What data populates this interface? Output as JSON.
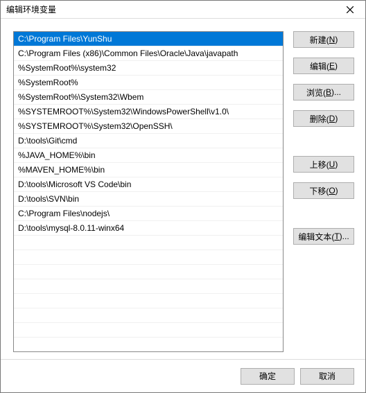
{
  "window": {
    "title": "编辑环境变量"
  },
  "path_entries": [
    "C:\\Program Files\\YunShu",
    "C:\\Program Files (x86)\\Common Files\\Oracle\\Java\\javapath",
    "%SystemRoot%\\system32",
    "%SystemRoot%",
    "%SystemRoot%\\System32\\Wbem",
    "%SYSTEMROOT%\\System32\\WindowsPowerShell\\v1.0\\",
    "%SYSTEMROOT%\\System32\\OpenSSH\\",
    "D:\\tools\\Git\\cmd",
    "%JAVA_HOME%\\bin",
    "%MAVEN_HOME%\\bin",
    "D:\\tools\\Microsoft VS Code\\bin",
    "D:\\tools\\SVN\\bin",
    "C:\\Program Files\\nodejs\\",
    "D:\\tools\\mysql-8.0.11-winx64"
  ],
  "selected_index": 0,
  "buttons": {
    "new": {
      "label": "新建",
      "hotkey": "N"
    },
    "edit": {
      "label": "编辑",
      "hotkey": "E"
    },
    "browse": {
      "label": "浏览",
      "hotkey": "B",
      "suffix": "..."
    },
    "delete": {
      "label": "删除",
      "hotkey": "D"
    },
    "move_up": {
      "label": "上移",
      "hotkey": "U"
    },
    "move_down": {
      "label": "下移",
      "hotkey": "O"
    },
    "edit_text": {
      "label": "编辑文本",
      "hotkey": "T",
      "suffix": "..."
    },
    "ok": {
      "label": "确定"
    },
    "cancel": {
      "label": "取消"
    }
  }
}
